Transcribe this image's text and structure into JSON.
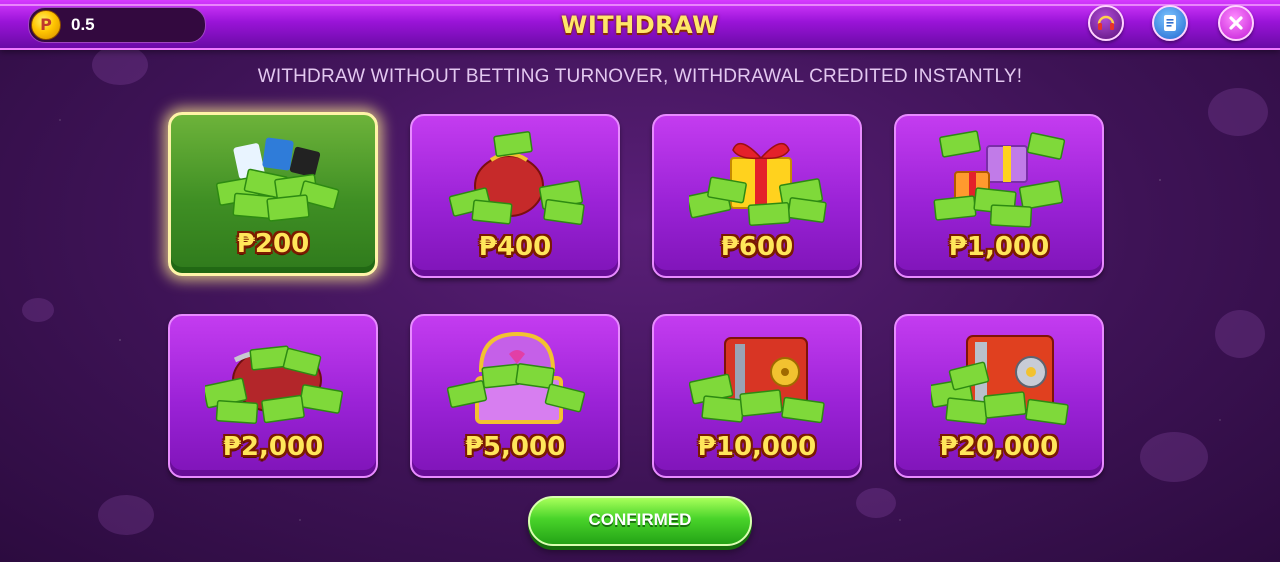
{
  "header": {
    "title": "WITHDRAW",
    "balance": "0.5",
    "coin_symbol": "P",
    "icons": [
      "headset-icon",
      "document-icon",
      "close-icon"
    ]
  },
  "subtitle": "WITHDRAW WITHOUT BETTING TURNOVER, WITHDRAWAL CREDITED INSTANTLY!",
  "options": [
    {
      "price": "₱200",
      "selected": true,
      "art": "cash-and-cards"
    },
    {
      "price": "₱400",
      "selected": false,
      "art": "money-bag"
    },
    {
      "price": "₱600",
      "selected": false,
      "art": "gift-box-cash"
    },
    {
      "price": "₱1,000",
      "selected": false,
      "art": "gift-pile-cash"
    },
    {
      "price": "₱2,000",
      "selected": false,
      "art": "cash-purse"
    },
    {
      "price": "₱5,000",
      "selected": false,
      "art": "treasure-chest"
    },
    {
      "price": "₱10,000",
      "selected": false,
      "art": "safe-cash"
    },
    {
      "price": "₱20,000",
      "selected": false,
      "art": "vault-cash"
    }
  ],
  "confirm_label": "CONFIRMED",
  "colors": {
    "card_purple": "#9a22d6",
    "card_selected_green": "#3f8f24",
    "price_yellow": "#ffe65a",
    "confirm_green": "#49d42a",
    "title_yellow": "#ffe76a"
  }
}
